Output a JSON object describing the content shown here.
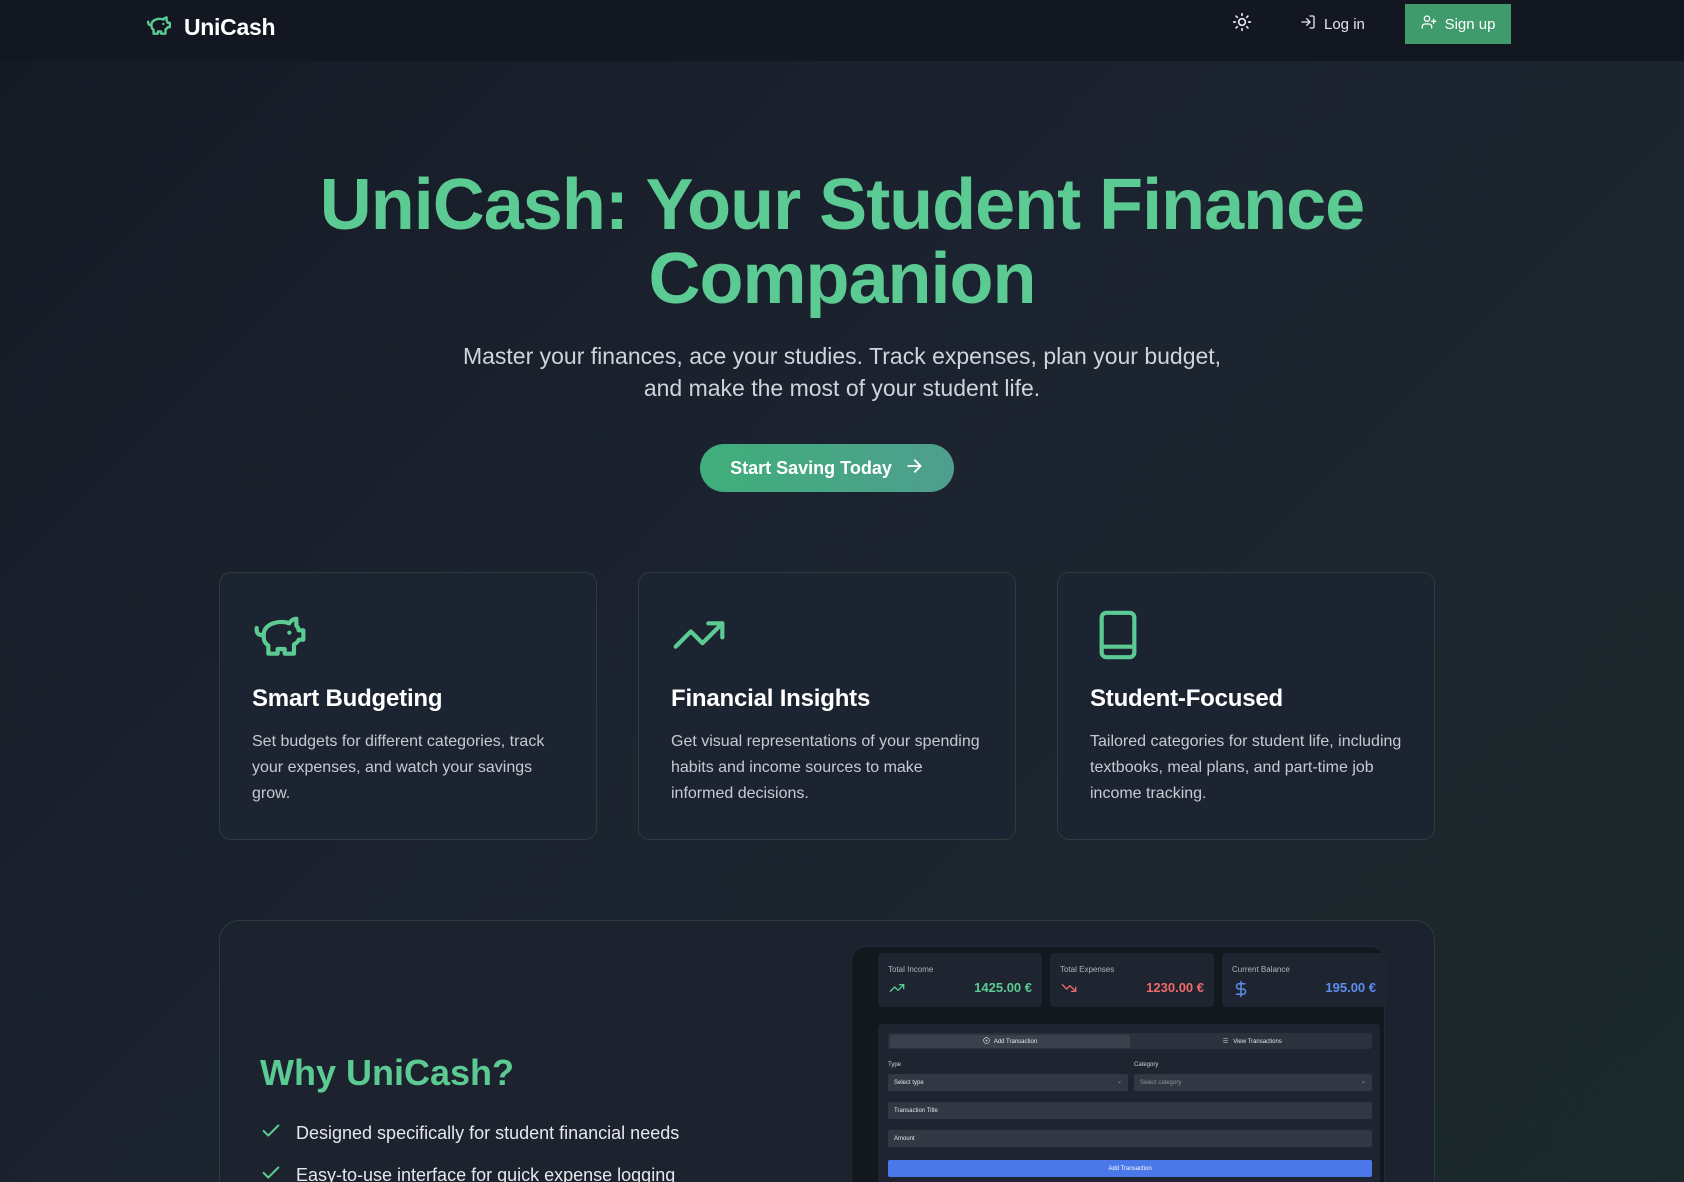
{
  "nav": {
    "brand": "UniCash",
    "login_label": "Log in",
    "signup_label": "Sign up"
  },
  "hero": {
    "title_line1": "UniCash: Your Student Finance",
    "title_line2": "Companion",
    "subtitle_line1": "Master your finances, ace your studies. Track expenses, plan your budget,",
    "subtitle_line2": "and make the most of your student life.",
    "cta_label": "Start Saving Today"
  },
  "features": [
    {
      "icon": "piggy-bank-icon",
      "title": "Smart Budgeting",
      "description": "Set budgets for different categories, track your expenses, and watch your savings grow."
    },
    {
      "icon": "trending-up-icon",
      "title": "Financial Insights",
      "description": "Get visual representations of your spending habits and income sources to make informed decisions."
    },
    {
      "icon": "book-icon",
      "title": "Student-Focused",
      "description": "Tailored categories for student life, including textbooks, meal plans, and part-time job income tracking."
    }
  ],
  "why": {
    "title": "Why UniCash?",
    "items": [
      "Designed specifically for student financial needs",
      "Easy-to-use interface for quick expense logging"
    ]
  },
  "mockup": {
    "stats": [
      {
        "label": "Total Income",
        "value": "1425.00 €",
        "icon": "trending-up-icon",
        "color": "#5ccb93"
      },
      {
        "label": "Total Expenses",
        "value": "1230.00 €",
        "icon": "trending-down-icon",
        "color": "#f06a6a"
      },
      {
        "label": "Current Balance",
        "value": "195.00 €",
        "icon": "dollar-icon",
        "color": "#5b8ef0"
      }
    ],
    "tabs": {
      "add": "Add Transaction",
      "view": "View Transactions"
    },
    "form": {
      "type_label": "Type",
      "type_value": "Select type",
      "category_label": "Category",
      "category_value": "Select category",
      "title_placeholder": "Transaction Title",
      "amount_placeholder": "Amount",
      "submit_label": "Add Transaction"
    }
  },
  "colors": {
    "accent": "#5ccb93",
    "button": "#3f9a6c",
    "background": "#1a212c",
    "expense": "#f06a6a",
    "balance": "#5b8ef0"
  }
}
